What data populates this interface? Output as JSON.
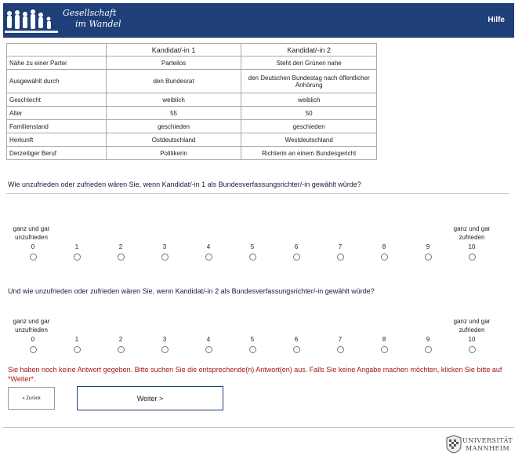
{
  "header": {
    "logo_line1": "Gesellschaft",
    "logo_line2": "im Wandel",
    "help_label": "Hilfe",
    "bg_color": "#1e3f78"
  },
  "table": {
    "columns": [
      "",
      "Kandidat/-in 1",
      "Kandidat/-in 2"
    ],
    "rows": [
      {
        "label": "Nähe zu einer Partei",
        "c1": "Parteilos",
        "c2": "Steht den Grünen nahe"
      },
      {
        "label": "Ausgewählt durch",
        "c1": "den Bundesrat",
        "c2": "den Deutschen Bundestag nach öffentlicher Anhörung"
      },
      {
        "label": "Geschlecht",
        "c1": "weiblich",
        "c2": "weiblich"
      },
      {
        "label": "Alter",
        "c1": "55",
        "c2": "50"
      },
      {
        "label": "Familienstand",
        "c1": "geschieden",
        "c2": "geschieden"
      },
      {
        "label": "Herkunft",
        "c1": "Ostdeutschland",
        "c2": "Westdeutschland"
      },
      {
        "label": "Derzeitiger Beruf",
        "c1": "Politikerin",
        "c2": "Richterin an einem Bundesgericht"
      }
    ]
  },
  "question1": {
    "text": "Wie unzufrieden oder zufrieden wären Sie, wenn Kandidat/-in 1 als Bundesverfassungsrichter/-in gewählt würde?",
    "left_anchor": "ganz und gar unzufrieden",
    "right_anchor": "ganz und gar zufrieden",
    "points": [
      "0",
      "1",
      "2",
      "3",
      "4",
      "5",
      "6",
      "7",
      "8",
      "9",
      "10"
    ]
  },
  "question2": {
    "text": "Und wie unzufrieden oder zufrieden wären Sie, wenn Kandidat/-in 2 als Bundesverfassungsrichter/-in gewählt würde?",
    "left_anchor": "ganz und gar unzufrieden",
    "right_anchor": "ganz und gar zufrieden",
    "points": [
      "0",
      "1",
      "2",
      "3",
      "4",
      "5",
      "6",
      "7",
      "8",
      "9",
      "10"
    ]
  },
  "error_message": "Sie haben noch keine Antwort gegeben. Bitte suchen Sie die entsprechende(n) Antwort(en) aus. Falls Sie keine Angabe machen möchten, klicken Sie bitte auf *Weiter*.",
  "nav": {
    "back_label": "« Zurück",
    "next_label": "Weiter >"
  },
  "footer": {
    "uni_line1": "UNIVERSITÄT",
    "uni_line2": "MANNHEIM"
  }
}
